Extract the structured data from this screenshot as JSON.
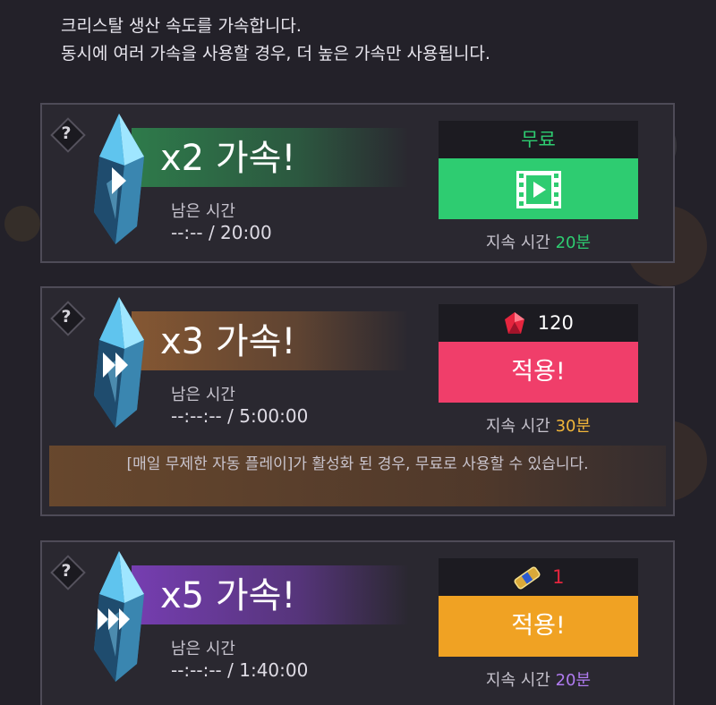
{
  "intro": {
    "line1": "크리스탈 생산 속도를 가속합니다.",
    "line2": "동시에 여러 가속을 사용할 경우, 더 높은 가속만 사용됩니다."
  },
  "help_symbol": "?",
  "remain_label": "남은 시간",
  "duration_label": "지속 시간",
  "boosts": [
    {
      "title": "x2 가속!",
      "remaining": "--:-- / 20:00",
      "cost_text": "무료",
      "cost_icon": "film-play-icon",
      "action_label": "",
      "duration": "20분",
      "button_color": "#2ecc71",
      "duration_color": "#2ecc71",
      "banner_color": "#2e7f4c"
    },
    {
      "title": "x3 가속!",
      "remaining": "--:--:-- / 5:00:00",
      "cost_icon": "ruby-icon",
      "cost_amount": "120",
      "action_label": "적용!",
      "duration": "30분",
      "button_color": "#f03e6a",
      "duration_color": "#f1b63a",
      "banner_color": "#8a5a33",
      "notice": "[매일 무제한 자동 플레이]가 활성화 된 경우, 무료로 사용할 수 있습니다."
    },
    {
      "title": "x5 가속!",
      "remaining": "--:--:-- / 1:40:00",
      "cost_icon": "ticket-icon",
      "cost_amount": "1",
      "action_label": "적용!",
      "duration": "20분",
      "button_color": "#f0a223",
      "duration_color": "#b07bf0",
      "banner_color": "#7a3fb8"
    }
  ]
}
